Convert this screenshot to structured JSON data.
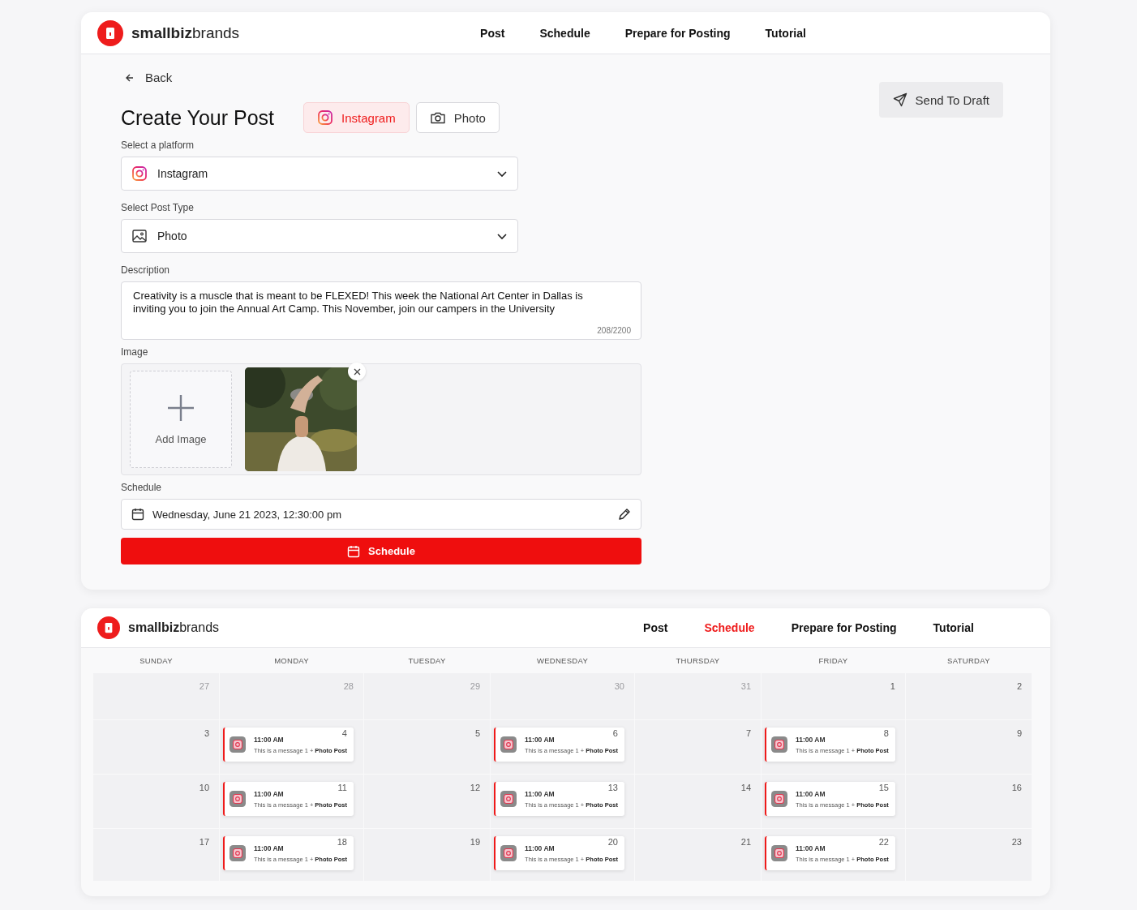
{
  "composer": {
    "brand": {
      "bold": "smallbiz",
      "light": "brands"
    },
    "nav": [
      {
        "label": "Post",
        "selected": false
      },
      {
        "label": "Schedule",
        "selected": false
      },
      {
        "label": "Prepare for Posting",
        "selected": false
      },
      {
        "label": "Tutorial",
        "selected": false
      }
    ],
    "back": "Back",
    "send_button": "Send To Draft",
    "title": "Create Your Post",
    "chips": [
      {
        "label": "Instagram",
        "kind": "instagram",
        "selected": true
      },
      {
        "label": "Photo",
        "kind": "camera",
        "selected": false
      }
    ],
    "platform": {
      "label": "Select a platform",
      "value": "Instagram"
    },
    "post_type": {
      "label": "Select Post Type",
      "value": "Photo"
    },
    "description": {
      "label": "Description",
      "value": "Creativity is a muscle that is meant to be FLEXED! This week the National Art Center in Dallas is inviting you to join the Annual Art Camp. This November, join our campers in the University",
      "counter": "208/2200"
    },
    "image": {
      "label": "Image",
      "add_label": "Add Image"
    },
    "schedule": {
      "label": "Schedule",
      "value": "Wednesday, June 21 2023, 12:30:00 pm",
      "button": "Schedule"
    }
  },
  "calendar": {
    "brand": {
      "bold": "smallbiz",
      "light": "brands"
    },
    "nav": [
      {
        "label": "Post",
        "selected": false
      },
      {
        "label": "Schedule",
        "selected": true
      },
      {
        "label": "Prepare for Posting",
        "selected": false
      },
      {
        "label": "Tutorial",
        "selected": false
      }
    ],
    "weekdays": [
      "SUNDAY",
      "MONDAY",
      "TUESDAY",
      "WEDNESDAY",
      "THURSDAY",
      "FRIDAY",
      "SATURDAY"
    ],
    "weeks": [
      {
        "days": [
          {
            "day": "27",
            "muted": true
          },
          {
            "day": "28",
            "muted": true
          },
          {
            "day": "29",
            "muted": true
          },
          {
            "day": "30",
            "muted": true
          },
          {
            "day": "31",
            "muted": true
          },
          {
            "day": "1",
            "muted": false
          },
          {
            "day": "2",
            "muted": false
          }
        ]
      },
      {
        "days": [
          {
            "day": "3",
            "muted": false
          },
          {
            "day": "4",
            "muted": false,
            "event": {
              "time": "11:00 AM",
              "message": "This is a message 1 + **Photo Post**"
            }
          },
          {
            "day": "5",
            "muted": false
          },
          {
            "day": "6",
            "muted": false,
            "event": {
              "time": "11:00 AM",
              "message": "This is a message 1 + **Photo Post**"
            }
          },
          {
            "day": "7",
            "muted": false
          },
          {
            "day": "8",
            "muted": false,
            "event": {
              "time": "11:00 AM",
              "message": "This is a message 1 + **Photo Post**"
            }
          },
          {
            "day": "9",
            "muted": false
          }
        ]
      },
      {
        "days": [
          {
            "day": "10",
            "muted": false
          },
          {
            "day": "11",
            "muted": false,
            "event": {
              "time": "11:00 AM",
              "message": "This is a message 1 + **Photo Post**"
            }
          },
          {
            "day": "12",
            "muted": false
          },
          {
            "day": "13",
            "muted": false,
            "event": {
              "time": "11:00 AM",
              "message": "This is a message 1 + **Photo Post**"
            }
          },
          {
            "day": "14",
            "muted": false
          },
          {
            "day": "15",
            "muted": false,
            "event": {
              "time": "11:00 AM",
              "message": "This is a message 1 + **Photo Post**"
            }
          },
          {
            "day": "16",
            "muted": false
          }
        ]
      },
      {
        "days": [
          {
            "day": "17",
            "muted": false
          },
          {
            "day": "18",
            "muted": false,
            "event": {
              "time": "11:00 AM",
              "message": "This is a message 1 + **Photo Post**"
            }
          },
          {
            "day": "19",
            "muted": false
          },
          {
            "day": "20",
            "muted": false,
            "event": {
              "time": "11:00 AM",
              "message": "This is a message 1 + **Photo Post**"
            }
          },
          {
            "day": "21",
            "muted": false
          },
          {
            "day": "22",
            "muted": false,
            "event": {
              "time": "11:00 AM",
              "message": "This is a message 1 + **Photo Post**"
            }
          },
          {
            "day": "23",
            "muted": false
          }
        ]
      }
    ]
  }
}
